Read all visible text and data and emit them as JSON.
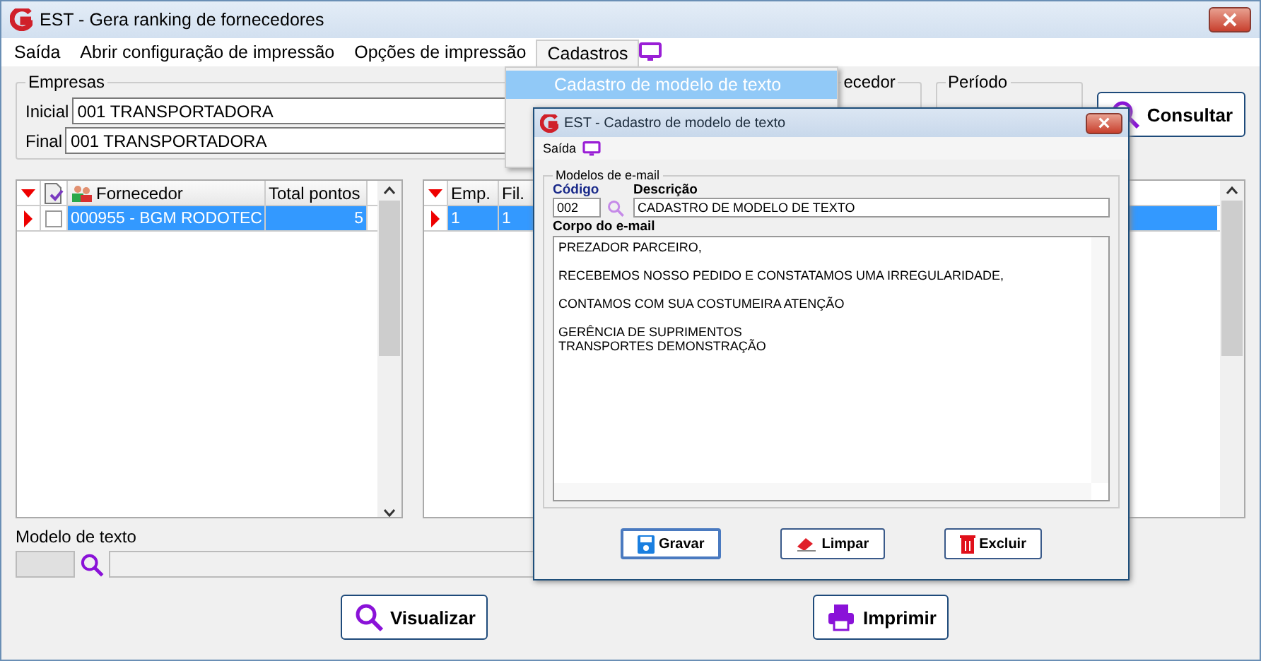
{
  "window": {
    "title": "EST - Gera ranking de fornecedores"
  },
  "menu": [
    {
      "label": "Saída",
      "open": false
    },
    {
      "label": "Abrir configuração de impressão",
      "open": false
    },
    {
      "label": "Opções de impressão",
      "open": false
    },
    {
      "label": "Cadastros",
      "open": true
    }
  ],
  "dropdown": {
    "items": [
      {
        "label": "Cadastro de modelo de texto",
        "selected": true
      }
    ]
  },
  "empresas": {
    "title": "Empresas",
    "fields": [
      {
        "label": "Inicial",
        "value": "001 TRANSPORTADORA"
      },
      {
        "label": "Final",
        "value": "001 TRANSPORTADORA"
      }
    ]
  },
  "fornecedor_group": {
    "title": "ecedor"
  },
  "periodo_group": {
    "title": "Período"
  },
  "consultar_button": "Consultar",
  "left_grid": {
    "columns": [
      "Fornecedor",
      "Total pontos"
    ],
    "rows": [
      {
        "fornecedor": "000955 - BGM RODOTEC",
        "total": "5",
        "selected": true,
        "checked": false
      }
    ]
  },
  "right_grid": {
    "columns": [
      "Emp.",
      "Fil."
    ],
    "rows": [
      {
        "cells": [
          "1",
          "1"
        ],
        "selected": true
      }
    ]
  },
  "modelo": {
    "label": "Modelo de texto"
  },
  "buttons": [
    {
      "kind": "view",
      "label": "Visualizar"
    },
    {
      "kind": "print",
      "label": "Imprimir"
    }
  ],
  "dialog": {
    "title": "EST - Cadastro de modelo de texto",
    "menu": "Saída",
    "group": "Modelos de e-mail",
    "codigo_label": "Código",
    "codigo": "002",
    "descricao_label": "Descrição",
    "descricao": "CADASTRO DE MODELO DE TEXTO",
    "body_label": "Corpo do e-mail",
    "body": [
      [
        "PREZADOR PARCEIRO,"
      ],
      [
        "RECEBEMOS NOSSO PEDIDO E CONSTATAMOS UMA IRREGULARIDADE,"
      ],
      [
        "CONTAMOS COM SUA COSTUMEIRA ATENÇÃO"
      ],
      [
        "GERÊNCIA DE SUPRIMENTOS",
        "TRANSPORTES DEMONSTRAÇÃO"
      ]
    ],
    "buttons": [
      {
        "kind": "save",
        "label": "Gravar"
      },
      {
        "kind": "clear",
        "label": "Limpar"
      },
      {
        "kind": "delete",
        "label": "Excluir"
      }
    ]
  }
}
